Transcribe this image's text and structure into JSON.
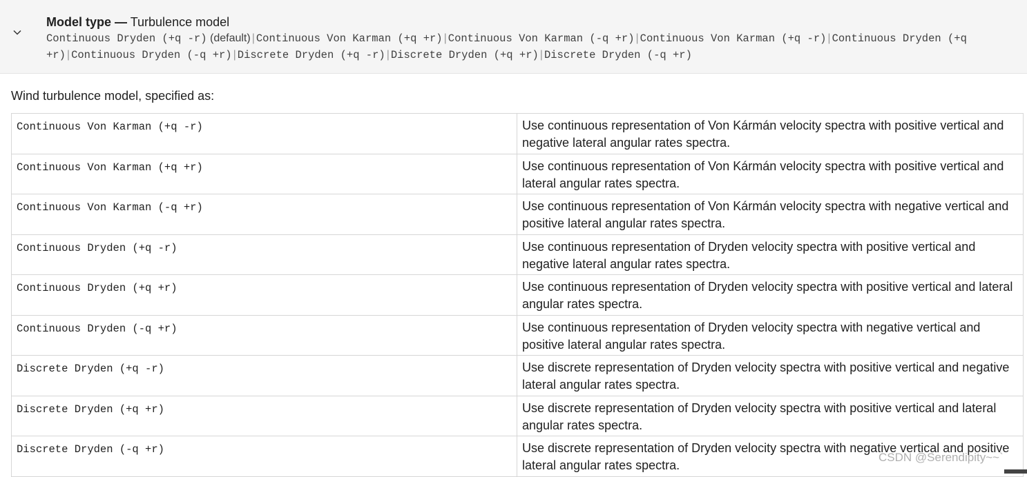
{
  "header": {
    "title_bold": "Model type —",
    "title_rest": "Turbulence model",
    "values": [
      {
        "text": "Continuous Dryden (+q -r)",
        "note": "(default)"
      },
      {
        "text": "Continuous Von Karman (+q +r)"
      },
      {
        "text": "Continuous Von Karman (-q +r)"
      },
      {
        "text": "Continuous Von Karman (+q -r)"
      },
      {
        "text": "Continuous Dryden (+q +r)"
      },
      {
        "text": "Continuous Dryden (-q +r)"
      },
      {
        "text": "Discrete Dryden (+q -r)"
      },
      {
        "text": "Discrete Dryden (+q +r)"
      },
      {
        "text": "Discrete Dryden (-q +r)"
      }
    ],
    "separator": "|",
    "chevron_icon": "chevron-down-icon"
  },
  "intro": "Wind turbulence model, specified as:",
  "table": {
    "rows": [
      {
        "model": "Continuous Von Karman (+q -r)",
        "desc": "Use continuous representation of Von Kármán velocity spectra with positive vertical and negative lateral angular rates spectra."
      },
      {
        "model": "Continuous Von Karman (+q +r)",
        "desc": "Use continuous representation of Von Kármán velocity spectra with positive vertical and lateral angular rates spectra."
      },
      {
        "model": "Continuous Von Karman (-q +r)",
        "desc": "Use continuous representation of Von Kármán velocity spectra with negative vertical and positive lateral angular rates spectra."
      },
      {
        "model": "Continuous Dryden (+q -r)",
        "desc": "Use continuous representation of Dryden velocity spectra with positive vertical and negative lateral angular rates spectra."
      },
      {
        "model": "Continuous Dryden (+q +r)",
        "desc": "Use continuous representation of Dryden velocity spectra with positive vertical and lateral angular rates spectra."
      },
      {
        "model": "Continuous Dryden (-q +r)",
        "desc": "Use continuous representation of Dryden velocity spectra with negative vertical and positive lateral angular rates spectra."
      },
      {
        "model": "Discrete Dryden (+q -r)",
        "desc": "Use discrete representation of Dryden velocity spectra with positive vertical and negative lateral angular rates spectra."
      },
      {
        "model": "Discrete Dryden (+q +r)",
        "desc": "Use discrete representation of Dryden velocity spectra with positive vertical and lateral angular rates spectra."
      },
      {
        "model": "Discrete Dryden (-q +r)",
        "desc": "Use discrete representation of Dryden velocity spectra with negative vertical and positive lateral angular rates spectra."
      }
    ]
  },
  "watermark": "CSDN @Serendipity~~`",
  "colors": {
    "header_bg": "#f5f5f5",
    "border": "#d6d6d6",
    "text": "#212121"
  }
}
